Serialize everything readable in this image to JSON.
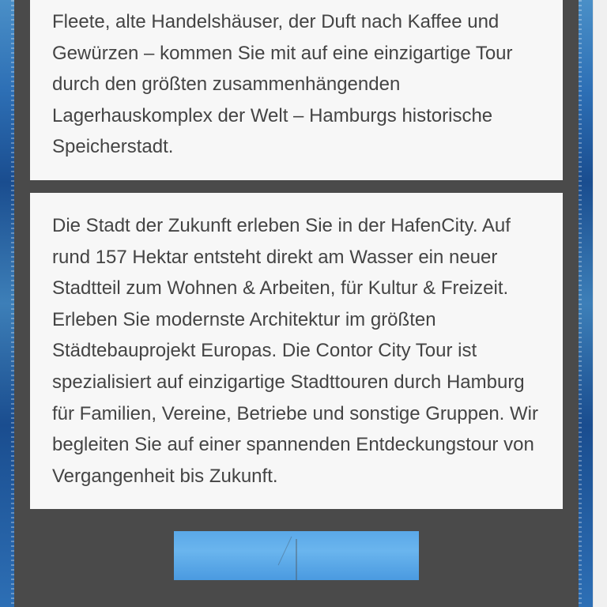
{
  "content": {
    "paragraph1": "Fleete, alte Handelshäuser, der Duft nach Kaffee und Gewürzen – kommen Sie mit auf eine einzigartige Tour durch den größten zusammenhängenden Lagerhauskomplex der Welt – Hamburgs historische Speicherstadt.",
    "paragraph2": "Die Stadt der Zukunft erleben Sie in der HafenCity. Auf rund 157 Hektar entsteht direkt am Wasser ein neuer Stadtteil zum Wohnen & Arbeiten, für Kultur & Freizeit. Erleben Sie modernste Architektur im größten Städtebauprojekt Europas. Die Contor City Tour ist spezialisiert auf einzigartige Stadttouren durch Hamburg für Familien, Vereine, Betriebe und sonstige Gruppen. Wir begleiten Sie auf einer spannenden Entdeckungstour von Vergangenheit bis Zukunft."
  }
}
